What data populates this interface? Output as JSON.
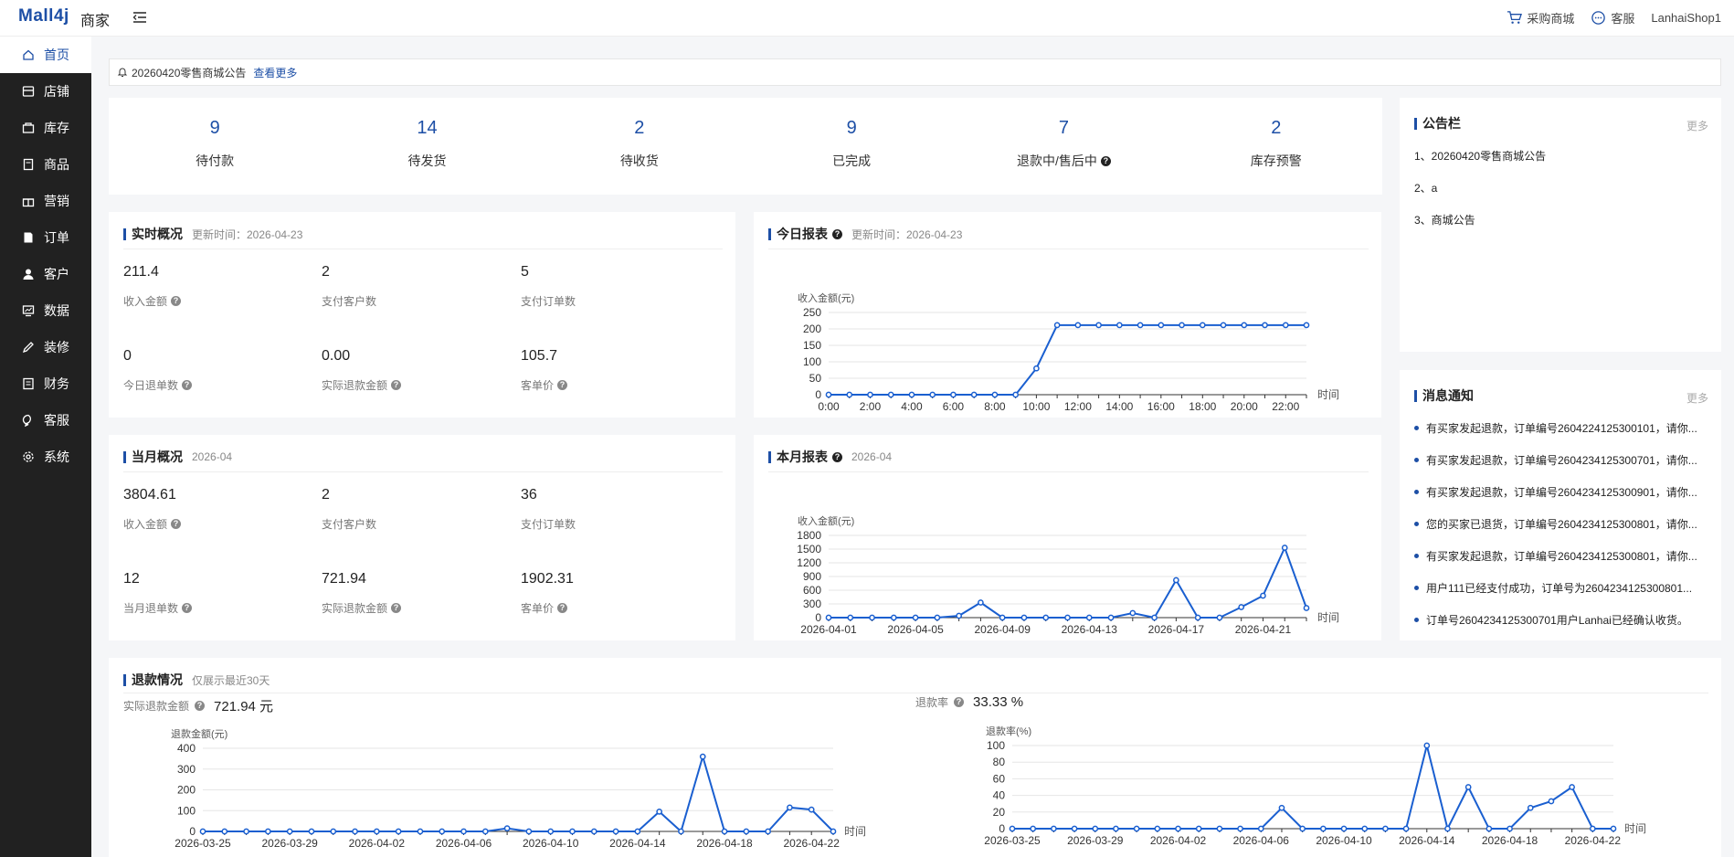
{
  "header": {
    "logo": "Mall4j",
    "logo_sub": "商家",
    "purchase_mall": "采购商城",
    "customer_service": "客服",
    "username": "LanhaiShop1"
  },
  "sidebar": {
    "items": [
      {
        "label": "首页",
        "icon": "home-icon"
      },
      {
        "label": "店铺",
        "icon": "shop-icon"
      },
      {
        "label": "库存",
        "icon": "inventory-icon"
      },
      {
        "label": "商品",
        "icon": "product-icon"
      },
      {
        "label": "营销",
        "icon": "gift-icon"
      },
      {
        "label": "订单",
        "icon": "order-icon"
      },
      {
        "label": "客户",
        "icon": "user-icon"
      },
      {
        "label": "数据",
        "icon": "data-icon"
      },
      {
        "label": "装修",
        "icon": "decorate-icon"
      },
      {
        "label": "财务",
        "icon": "finance-icon"
      },
      {
        "label": "客服",
        "icon": "chat-icon"
      },
      {
        "label": "系统",
        "icon": "gear-icon"
      }
    ]
  },
  "notice": {
    "text": "20260420零售商城公告",
    "more": "查看更多"
  },
  "stats": [
    {
      "value": "9",
      "label": "待付款"
    },
    {
      "value": "14",
      "label": "待发货"
    },
    {
      "value": "2",
      "label": "待收货"
    },
    {
      "value": "9",
      "label": "已完成"
    },
    {
      "value": "7",
      "label": "退款中/售后中"
    },
    {
      "value": "2",
      "label": "库存预警"
    }
  ],
  "realtime": {
    "title": "实时概况",
    "subtitle": "更新时间：2026-04-23",
    "metrics": [
      {
        "value": "211.4",
        "label": "收入金额"
      },
      {
        "value": "2",
        "label": "支付客户数"
      },
      {
        "value": "5",
        "label": "支付订单数"
      },
      {
        "value": "0",
        "label": "今日退单数"
      },
      {
        "value": "0.00",
        "label": "实际退款金额"
      },
      {
        "value": "105.7",
        "label": "客单价"
      }
    ]
  },
  "monthly": {
    "title": "当月概况",
    "subtitle": "2026-04",
    "metrics": [
      {
        "value": "3804.61",
        "label": "收入金额"
      },
      {
        "value": "2",
        "label": "支付客户数"
      },
      {
        "value": "36",
        "label": "支付订单数"
      },
      {
        "value": "12",
        "label": "当月退单数"
      },
      {
        "value": "721.94",
        "label": "实际退款金额"
      },
      {
        "value": "1902.31",
        "label": "客单价"
      }
    ]
  },
  "today_report": {
    "title": "今日报表",
    "subtitle": "更新时间：2026-04-23"
  },
  "month_report": {
    "title": "本月报表",
    "subtitle": "2026-04"
  },
  "announcement": {
    "title": "公告栏",
    "more": "更多",
    "items": [
      "1、20260420零售商城公告",
      "2、a",
      "3、商城公告"
    ]
  },
  "messages": {
    "title": "消息通知",
    "more": "更多",
    "items": [
      "有买家发起退款，订单编号2604224125300101，请你...",
      "有买家发起退款，订单编号2604234125300701，请你...",
      "有买家发起退款，订单编号2604234125300901，请你...",
      "您的买家已退货，订单编号2604234125300801，请你...",
      "有买家发起退款，订单编号2604234125300801，请你...",
      "用户111已经支付成功，订单号为2604234125300801...",
      "订单号2604234125300701用户Lanhai已经确认收货。"
    ]
  },
  "refund": {
    "title": "退款情况",
    "subtitle": "仅展示最近30天",
    "amount_label": "实际退款金额",
    "amount_value": "721.94 元",
    "rate_label": "退款率",
    "rate_value": "33.33 %"
  },
  "colors": {
    "accent": "#1d4fa6",
    "sidebar_bg": "#212121",
    "line": "#1a5fd0"
  },
  "chart_data": [
    {
      "type": "line",
      "ylabel": "收入金额(元)",
      "xlabel": "时间",
      "ylim": [
        0,
        250
      ],
      "yticks": [
        0,
        50,
        100,
        150,
        200,
        250
      ],
      "x": [
        "0:00",
        "1:00",
        "2:00",
        "3:00",
        "4:00",
        "5:00",
        "6:00",
        "7:00",
        "8:00",
        "9:00",
        "10:00",
        "11:00",
        "12:00",
        "13:00",
        "14:00",
        "15:00",
        "16:00",
        "17:00",
        "18:00",
        "19:00",
        "20:00",
        "21:00",
        "22:00",
        "23:00"
      ],
      "xtick_labels": [
        "0:00",
        "2:00",
        "4:00",
        "6:00",
        "8:00",
        "10:00",
        "12:00",
        "14:00",
        "16:00",
        "18:00",
        "20:00",
        "22:00"
      ],
      "values": [
        0,
        0,
        0,
        0,
        0,
        0,
        0,
        0,
        0,
        0,
        80,
        211.4,
        211.4,
        211.4,
        211.4,
        211.4,
        211.4,
        211.4,
        211.4,
        211.4,
        211.4,
        211.4,
        211.4,
        211.4
      ]
    },
    {
      "type": "line",
      "ylabel": "收入金额(元)",
      "xlabel": "时间",
      "ylim": [
        0,
        1800
      ],
      "yticks": [
        0,
        300,
        600,
        900,
        1200,
        1500,
        1800
      ],
      "x": [
        "2026-04-01",
        "2026-04-02",
        "2026-04-03",
        "2026-04-04",
        "2026-04-05",
        "2026-04-06",
        "2026-04-07",
        "2026-04-08",
        "2026-04-09",
        "2026-04-10",
        "2026-04-11",
        "2026-04-12",
        "2026-04-13",
        "2026-04-14",
        "2026-04-15",
        "2026-04-16",
        "2026-04-17",
        "2026-04-18",
        "2026-04-19",
        "2026-04-20",
        "2026-04-21",
        "2026-04-22",
        "2026-04-23"
      ],
      "xtick_labels": [
        "2026-04-01",
        "2026-04-05",
        "2026-04-09",
        "2026-04-13",
        "2026-04-17",
        "2026-04-21"
      ],
      "values": [
        0,
        0,
        0,
        0,
        0,
        0,
        40,
        330,
        0,
        0,
        0,
        0,
        0,
        0,
        100,
        0,
        820,
        0,
        0,
        230,
        480,
        1530,
        210
      ]
    },
    {
      "type": "line",
      "ylabel": "退款金额(元)",
      "xlabel": "时间",
      "ylim": [
        0,
        400
      ],
      "yticks": [
        0,
        100,
        200,
        300,
        400
      ],
      "x": [
        "2026-03-25",
        "2026-03-26",
        "2026-03-27",
        "2026-03-28",
        "2026-03-29",
        "2026-03-30",
        "2026-03-31",
        "2026-04-01",
        "2026-04-02",
        "2026-04-03",
        "2026-04-04",
        "2026-04-05",
        "2026-04-06",
        "2026-04-07",
        "2026-04-08",
        "2026-04-09",
        "2026-04-10",
        "2026-04-11",
        "2026-04-12",
        "2026-04-13",
        "2026-04-14",
        "2026-04-15",
        "2026-04-16",
        "2026-04-17",
        "2026-04-18",
        "2026-04-19",
        "2026-04-20",
        "2026-04-21",
        "2026-04-22",
        "2026-04-23"
      ],
      "xtick_labels": [
        "2026-03-25",
        "2026-03-29",
        "2026-04-02",
        "2026-04-06",
        "2026-04-10",
        "2026-04-14",
        "2026-04-18",
        "2026-04-22"
      ],
      "values": [
        0,
        0,
        0,
        0,
        0,
        0,
        0,
        0,
        0,
        0,
        0,
        0,
        0,
        0,
        15,
        0,
        0,
        0,
        0,
        0,
        0,
        95,
        0,
        360,
        0,
        0,
        0,
        115,
        105,
        0
      ]
    },
    {
      "type": "line",
      "ylabel": "退款率(%)",
      "xlabel": "时间",
      "ylim": [
        0,
        100
      ],
      "yticks": [
        0,
        20,
        40,
        60,
        80,
        100
      ],
      "x": [
        "2026-03-25",
        "2026-03-26",
        "2026-03-27",
        "2026-03-28",
        "2026-03-29",
        "2026-03-30",
        "2026-03-31",
        "2026-04-01",
        "2026-04-02",
        "2026-04-03",
        "2026-04-04",
        "2026-04-05",
        "2026-04-06",
        "2026-04-07",
        "2026-04-08",
        "2026-04-09",
        "2026-04-10",
        "2026-04-11",
        "2026-04-12",
        "2026-04-13",
        "2026-04-14",
        "2026-04-15",
        "2026-04-16",
        "2026-04-17",
        "2026-04-18",
        "2026-04-19",
        "2026-04-20",
        "2026-04-21",
        "2026-04-22",
        "2026-04-23"
      ],
      "xtick_labels": [
        "2026-03-25",
        "2026-03-29",
        "2026-04-02",
        "2026-04-06",
        "2026-04-10",
        "2026-04-14",
        "2026-04-18",
        "2026-04-22"
      ],
      "values": [
        0,
        0,
        0,
        0,
        0,
        0,
        0,
        0,
        0,
        0,
        0,
        0,
        0,
        25,
        0,
        0,
        0,
        0,
        0,
        0,
        100,
        0,
        50,
        0,
        0,
        25,
        33,
        50,
        0,
        0
      ]
    }
  ]
}
